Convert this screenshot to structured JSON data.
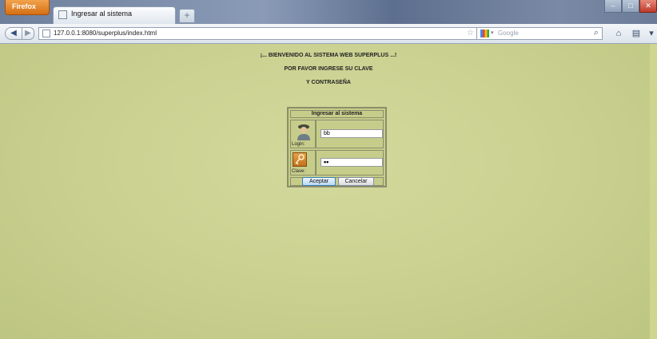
{
  "browser": {
    "menu_button": "Firefox",
    "tab_title": "Ingresar al sistema",
    "new_tab_label": "+",
    "url": "127.0.0.1:8080/superplus/index.html",
    "search_placeholder": "Google",
    "window_controls": {
      "minimize": "–",
      "maximize": "□",
      "close": "✕"
    }
  },
  "page": {
    "welcome": "¡... BIENVENIDO AL SISTEMA WEB SUPERPLUS ...!",
    "instruction1": "POR FAVOR INGRESE SU CLAVE",
    "instruction2": "Y CONTRASEÑA"
  },
  "login": {
    "header": "Ingresar al sistema",
    "login_label": "Login:",
    "login_value": "bb",
    "password_label": "Clave:",
    "password_value": "••",
    "accept_label": "Aceptar",
    "cancel_label": "Cancelar"
  },
  "colors": {
    "background": "#c7cf8c",
    "accept_border": "#3c7fb1"
  }
}
